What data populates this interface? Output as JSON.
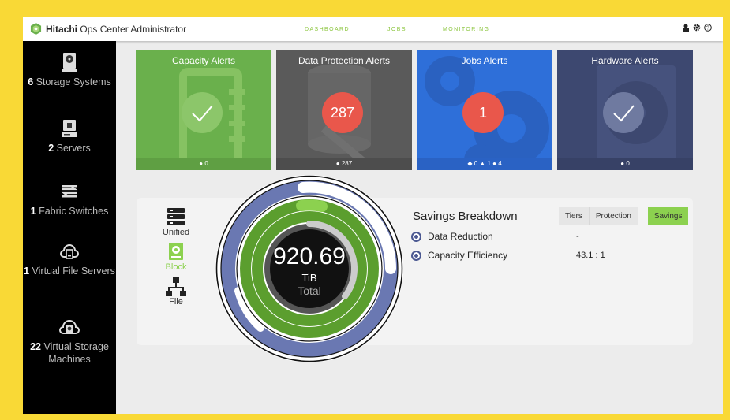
{
  "header": {
    "brand": "Hitachi",
    "app_name": "Ops Center Administrator",
    "nav": [
      "DASHBOARD",
      "JOBS",
      "MONITORING"
    ],
    "icons": [
      "user-icon",
      "gear-icon",
      "help-icon"
    ]
  },
  "sidebar": {
    "items": [
      {
        "count": "6",
        "label": "Storage Systems",
        "icon": "storage-system-icon"
      },
      {
        "count": "2",
        "label": "Servers",
        "icon": "server-icon"
      },
      {
        "count": "1",
        "label": "Fabric Switches",
        "icon": "fabric-switch-icon"
      },
      {
        "count": "1",
        "label": "Virtual File Servers",
        "icon": "virtual-file-server-icon"
      },
      {
        "count": "22",
        "label": "Virtual Storage Machines",
        "icon": "virtual-storage-machine-icon"
      }
    ]
  },
  "alerts": [
    {
      "title": "Capacity Alerts",
      "status": "ok",
      "footer": "0",
      "color": "#6ab04c"
    },
    {
      "title": "Data Protection Alerts",
      "badge": "287",
      "footer": "287",
      "color": "#5a5a5a"
    },
    {
      "title": "Jobs Alerts",
      "badge": "1",
      "footer": "◆ 0 ▲ 1 ● 4",
      "color": "#2e6fd9"
    },
    {
      "title": "Hardware Alerts",
      "status": "ok",
      "footer": "0",
      "color": "#3d4870"
    }
  ],
  "capacity": {
    "types": [
      "Unified",
      "Block",
      "File"
    ],
    "selected_type": "Block",
    "total_value": "920.69",
    "total_unit": "TiB",
    "total_label": "Total",
    "savings_title": "Savings Breakdown",
    "tabs": [
      "Tiers",
      "Protection",
      "Savings"
    ],
    "active_tab": "Savings",
    "rows": [
      {
        "label": "Data Reduction",
        "value": "-"
      },
      {
        "label": "Capacity Efficiency",
        "value": "43.1 : 1"
      }
    ],
    "colors": {
      "green": "#5b9e2e",
      "light_green": "#8cd14f",
      "blue": "#6a78b2",
      "dark": "#1a1a1a"
    }
  }
}
